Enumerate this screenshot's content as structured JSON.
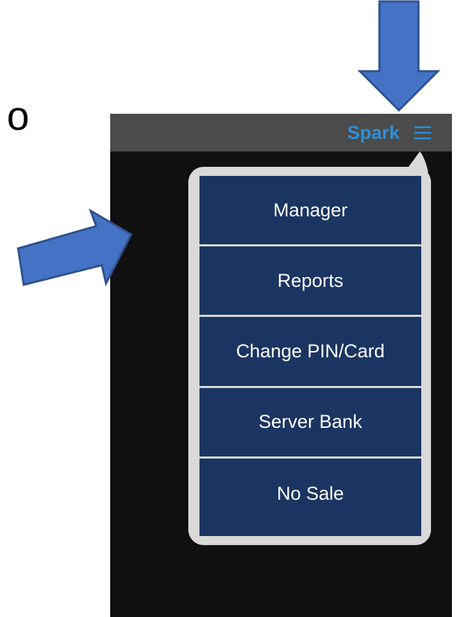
{
  "slide": {
    "fragment_text": "o"
  },
  "app": {
    "title": "Spark",
    "menu_icon": "hamburger-menu-icon",
    "accent_color": "#2d8fd8"
  },
  "menu": {
    "items": [
      {
        "label": "Manager"
      },
      {
        "label": "Reports"
      },
      {
        "label": "Change PIN/Card"
      },
      {
        "label": "Server Bank"
      },
      {
        "label": "No Sale"
      }
    ],
    "item_color": "#1b3562"
  },
  "annotations": {
    "arrow_color": "#4472c4"
  }
}
